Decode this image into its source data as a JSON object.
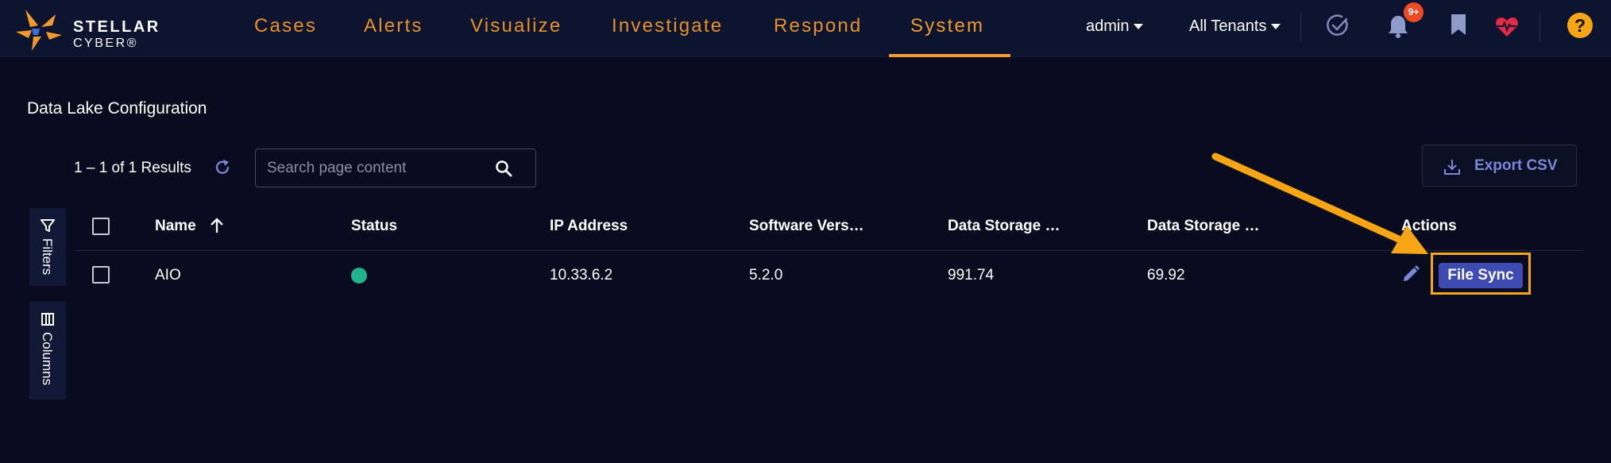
{
  "brand": {
    "line1": "STELLAR",
    "line2": "CYBER®",
    "logo_icon": "stellar-star-logo",
    "logo_colors": [
      "#f29a2e",
      "#3d6fd8"
    ]
  },
  "nav": {
    "items": [
      {
        "label": "Cases"
      },
      {
        "label": "Alerts"
      },
      {
        "label": "Visualize"
      },
      {
        "label": "Investigate"
      },
      {
        "label": "Respond"
      },
      {
        "label": "System"
      }
    ],
    "active": "System",
    "accent_color": "#f29a2e"
  },
  "header_right": {
    "user": "admin",
    "tenant": "All Tenants",
    "notification_badge": "9+",
    "icons": [
      "check-circle-icon",
      "bell-icon",
      "bookmark-icon",
      "heart-pulse-icon",
      "help-icon"
    ],
    "help_label": "?"
  },
  "page": {
    "title": "Data Lake Configuration",
    "results": "1 – 1 of 1 Results",
    "search_placeholder": "Search page content",
    "export_label": "Export CSV"
  },
  "side_tabs": {
    "filters": "Filters",
    "columns": "Columns"
  },
  "table": {
    "columns": [
      "Name",
      "Status",
      "IP Address",
      "Software Vers…",
      "Data Storage …",
      "Data Storage …",
      "Actions"
    ],
    "sort": {
      "column": "Name",
      "direction": "ascending"
    },
    "rows": [
      {
        "name": "AIO",
        "status": "online",
        "status_color": "#22b28c",
        "ip": "10.33.6.2",
        "software_version": "5.2.0",
        "data_storage_1": "991.74",
        "data_storage_2": "69.92",
        "action_label": "File Sync"
      }
    ]
  },
  "annotation": {
    "color": "#f5a516",
    "target": "File Sync"
  }
}
